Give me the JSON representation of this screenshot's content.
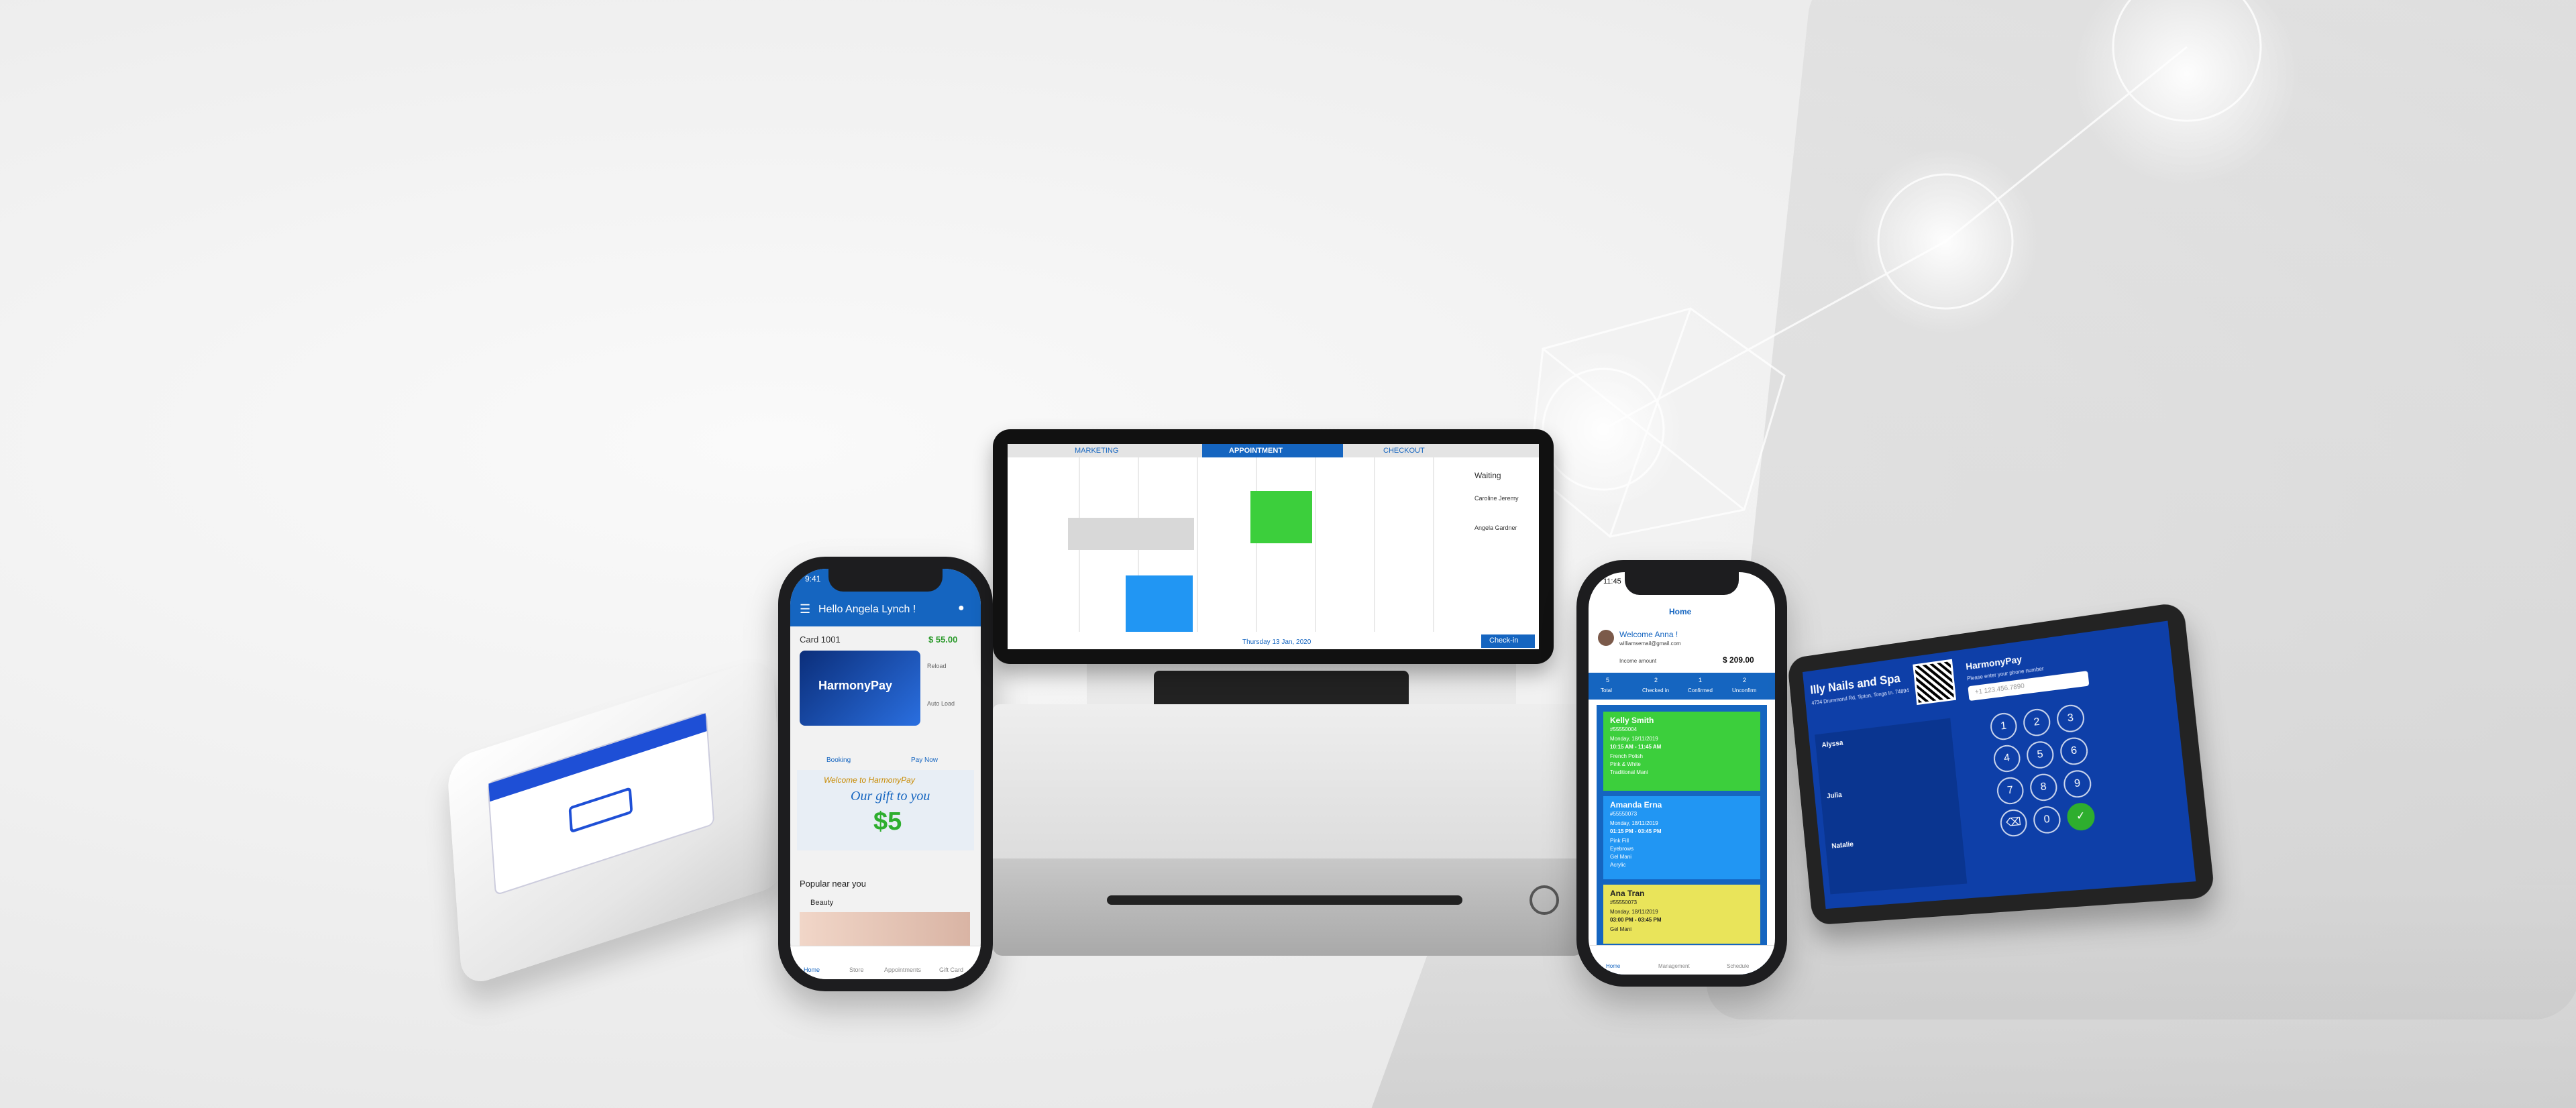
{
  "brand": {
    "name": "HarmonyPay",
    "logo_icon": "harmonypay-logo-icon"
  },
  "colors": {
    "brand_blue": "#1565c0",
    "appointment_green": "#3ccf3c",
    "appointment_blue": "#2196f3",
    "appointment_yellow": "#e9e45a"
  },
  "left_phone": {
    "time": "9:41",
    "greeting": "Hello Angela Lynch !",
    "card_number": "Card 1001",
    "balance": "$ 55.00",
    "card_brand": "HarmonyPay",
    "side_actions": [
      "Reload",
      "Auto Load"
    ],
    "actions": [
      "Booking",
      "Pay Now"
    ],
    "promo_title": "Welcome to HarmonyPay",
    "promo_subtitle": "Our gift to you",
    "promo_amount": "$5",
    "section": "Popular near you",
    "category": "Beauty",
    "nav": [
      "Home",
      "Store",
      "Appointments",
      "Gift Card"
    ]
  },
  "pos": {
    "tabs": [
      "MARKETING",
      "APPOINTMENT",
      "CHECKOUT"
    ],
    "waiting_label": "Waiting",
    "waiting_names": [
      "Caroline Jeremy",
      "Angela Gardner"
    ],
    "date": "Thursday 13 Jan, 2020",
    "checkin_label": "Check-in"
  },
  "right_phone": {
    "time": "11:45",
    "title": "Home",
    "welcome": "Welcome Anna !",
    "email": "williamsemail@gmail.com",
    "income_label": "Income amount",
    "income_value": "$ 209.00",
    "stats": [
      {
        "value": "5",
        "label": "Total"
      },
      {
        "value": "2",
        "label": "Checked in"
      },
      {
        "value": "1",
        "label": "Confirmed"
      },
      {
        "value": "2",
        "label": "Unconfirm"
      }
    ],
    "appointments": [
      {
        "name": "Kelly Smith",
        "id": "#55550004",
        "date": "Monday, 18/11/2019",
        "time": "10:15 AM - 11:45 AM",
        "services": [
          "French Polish",
          "Pink & White",
          "Traditional Mani"
        ]
      },
      {
        "name": "Amanda Erna",
        "id": "#55550073",
        "date": "Monday, 18/11/2019",
        "time": "01:15 PM - 03:45 PM",
        "services": [
          "Pink Fill",
          "Eyebrows",
          "Gel Mani",
          "Acrylic"
        ]
      },
      {
        "name": "Ana Tran",
        "id": "#55550073",
        "date": "Monday, 18/11/2019",
        "time": "03:00 PM - 03:45 PM",
        "services": [
          "Gel Mani"
        ]
      }
    ],
    "nav": [
      "Home",
      "Management",
      "Schedule"
    ]
  },
  "tablet": {
    "salon": "Illy Nails and Spa",
    "address": "4734 Drummond Rd, Tipton, Tonga In. 74894",
    "brand": "HarmonyPay",
    "prompt": "Please enter your phone number",
    "phone_placeholder": "+1  123.456.7890",
    "staff": [
      "Alyssa",
      "Julia",
      "Natalie"
    ],
    "keypad": [
      "1",
      "2",
      "3",
      "4",
      "5",
      "6",
      "7",
      "8",
      "9",
      "0"
    ]
  }
}
